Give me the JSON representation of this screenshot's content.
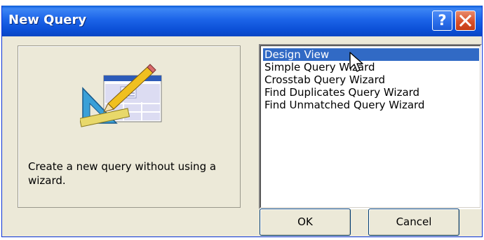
{
  "window": {
    "title": "New Query",
    "help_glyph": "?"
  },
  "left_panel": {
    "icon": "query-design-icon",
    "description": "Create a new query without using a wizard."
  },
  "query_types": {
    "items": [
      {
        "label": "Design View",
        "selected": true
      },
      {
        "label": "Simple Query Wizard",
        "selected": false
      },
      {
        "label": "Crosstab Query Wizard",
        "selected": false
      },
      {
        "label": "Find Duplicates Query Wizard",
        "selected": false
      },
      {
        "label": "Find Unmatched Query Wizard",
        "selected": false
      }
    ]
  },
  "buttons": {
    "ok_label": "OK",
    "cancel_label": "Cancel"
  },
  "colors": {
    "titlebar": "#0b4fd6",
    "selection": "#316ac5",
    "dialog_bg": "#ece9d8"
  }
}
